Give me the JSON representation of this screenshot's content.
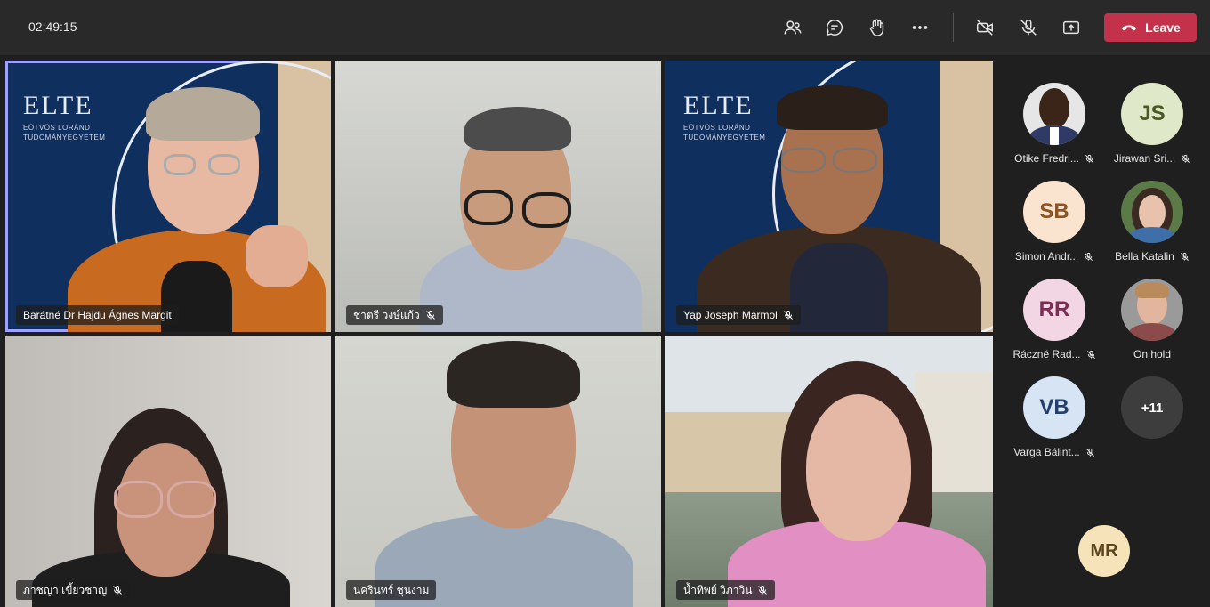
{
  "meeting": {
    "timer": "02:49:15",
    "leave_label": "Leave"
  },
  "toolbar": {
    "icons": [
      "people-icon",
      "chat-icon",
      "raise-hand-icon",
      "more-options-icon",
      "camera-off-icon",
      "mic-off-icon",
      "share-screen-icon",
      "phone-hangup-icon"
    ]
  },
  "elte": {
    "logo": "ELTE",
    "sub1": "EÖTVÖS LORÁND",
    "sub2": "TUDOMÁNYEGYETEM"
  },
  "tiles": [
    {
      "name": "Barátné Dr Hajdu Ágnes Margit",
      "muted": false
    },
    {
      "name": "ชาตรี วงษ์แก้ว",
      "muted": true
    },
    {
      "name": "Yap Joseph Marmol",
      "muted": true
    },
    {
      "name": "ภาชญา เขี้ยวชาญ",
      "muted": true
    },
    {
      "name": "นครินทร์ ชุนงาม",
      "muted": false
    },
    {
      "name": "น้ำทิพย์ วิภาวิน",
      "muted": true
    }
  ],
  "roster": [
    {
      "initials": "",
      "name": "Otike Fredri...",
      "muted": true,
      "avatar_color": "#3a3a3a"
    },
    {
      "initials": "JS",
      "name": "Jirawan Sri...",
      "muted": true,
      "avatar_color": "#dfe8c8"
    },
    {
      "initials": "SB",
      "name": "Simon Andr...",
      "muted": true,
      "avatar_color": "#fbe4cf"
    },
    {
      "initials": "",
      "name": "Bella Katalin",
      "muted": true,
      "avatar_color": "#5b7a48"
    },
    {
      "initials": "RR",
      "name": "Ráczné Rad...",
      "muted": true,
      "avatar_color": "#f3d6e4"
    },
    {
      "initials": "",
      "name": "On hold",
      "muted": false,
      "avatar_color": "#9a9a9a"
    },
    {
      "initials": "VB",
      "name": "Varga Bálint...",
      "muted": true,
      "avatar_color": "#d6e4f3"
    },
    {
      "initials": "+11",
      "name": "",
      "muted": false,
      "avatar_color": "#3d3d3d"
    }
  ],
  "self": {
    "initials": "MR"
  }
}
